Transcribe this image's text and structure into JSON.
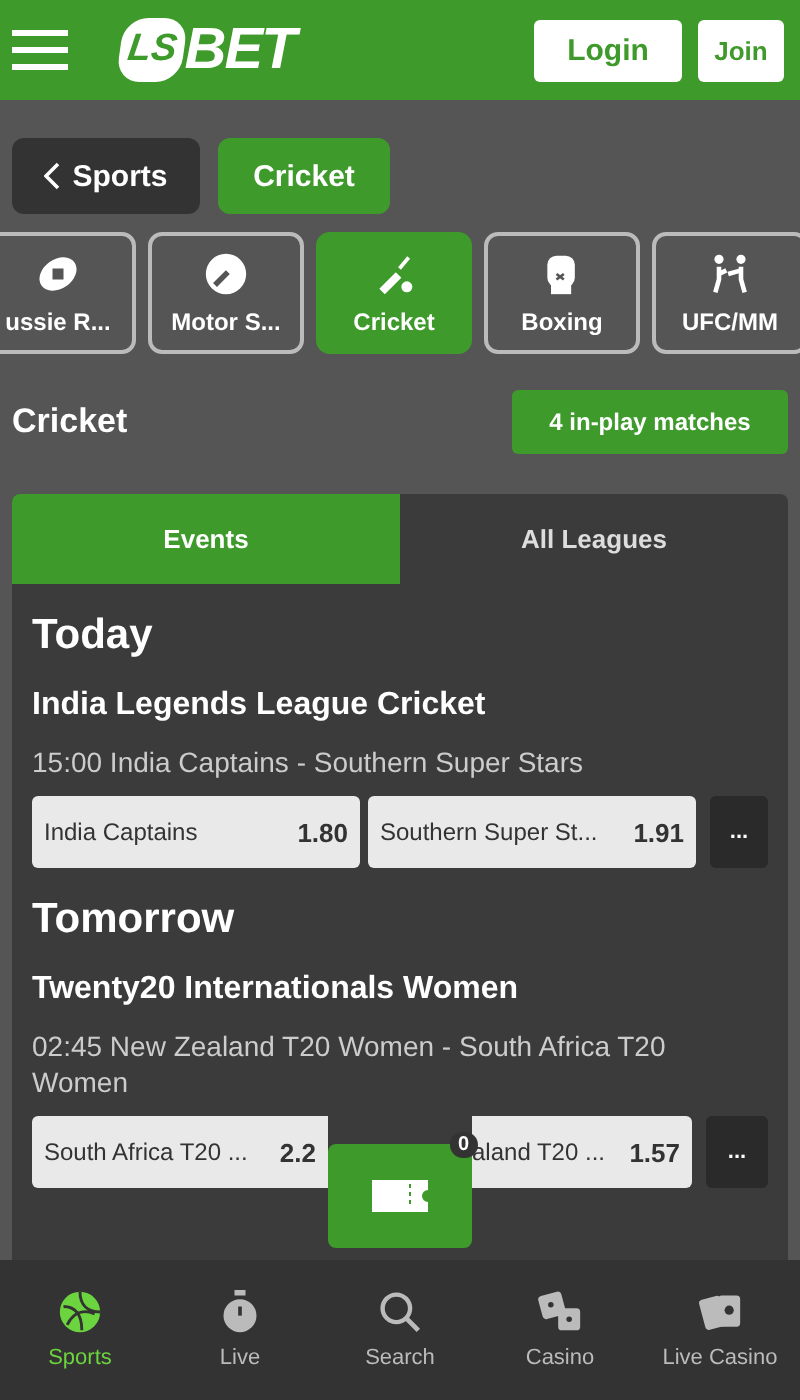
{
  "header": {
    "logo": {
      "mark": "LS",
      "text": "BET"
    },
    "login": "Login",
    "join": "Join"
  },
  "breadcrumb": {
    "back": "Sports",
    "current": "Cricket"
  },
  "sports": [
    {
      "label": "ussie R...",
      "kind": "football",
      "selected": false
    },
    {
      "label": "Motor S...",
      "kind": "motor",
      "selected": false
    },
    {
      "label": "Cricket",
      "kind": "cricket",
      "selected": true
    },
    {
      "label": "Boxing",
      "kind": "boxing",
      "selected": false
    },
    {
      "label": "UFC/MM",
      "kind": "mma",
      "selected": false
    }
  ],
  "title": "Cricket",
  "inplay": "4 in-play matches",
  "tabs": [
    {
      "label": "Events",
      "selected": true
    },
    {
      "label": "All Leagues",
      "selected": false
    }
  ],
  "days": [
    {
      "day": "Today",
      "league": "India Legends League Cricket",
      "match": "15:00 India Captains - Southern Super Stars",
      "more": "...",
      "odds": [
        {
          "name": "India Captains",
          "price": "1.80"
        },
        {
          "name": "Southern Super St...",
          "price": "1.91"
        }
      ]
    },
    {
      "day": "Tomorrow",
      "league": "Twenty20 Internationals Women",
      "match": "02:45 New Zealand T20 Women - South Africa T20 Women",
      "more": "...",
      "odds": [
        {
          "name": "South Africa T20 ...",
          "price": "2.2"
        },
        {
          "name": "aland T20 ...",
          "price": "1.57"
        }
      ]
    }
  ],
  "betslip": {
    "count": "0"
  },
  "nav": [
    {
      "label": "Sports",
      "kind": "sports",
      "selected": true
    },
    {
      "label": "Live",
      "kind": "live",
      "selected": false
    },
    {
      "label": "Search",
      "kind": "search",
      "selected": false
    },
    {
      "label": "Casino",
      "kind": "casino",
      "selected": false
    },
    {
      "label": "Live Casino",
      "kind": "livecasino",
      "selected": false
    }
  ]
}
